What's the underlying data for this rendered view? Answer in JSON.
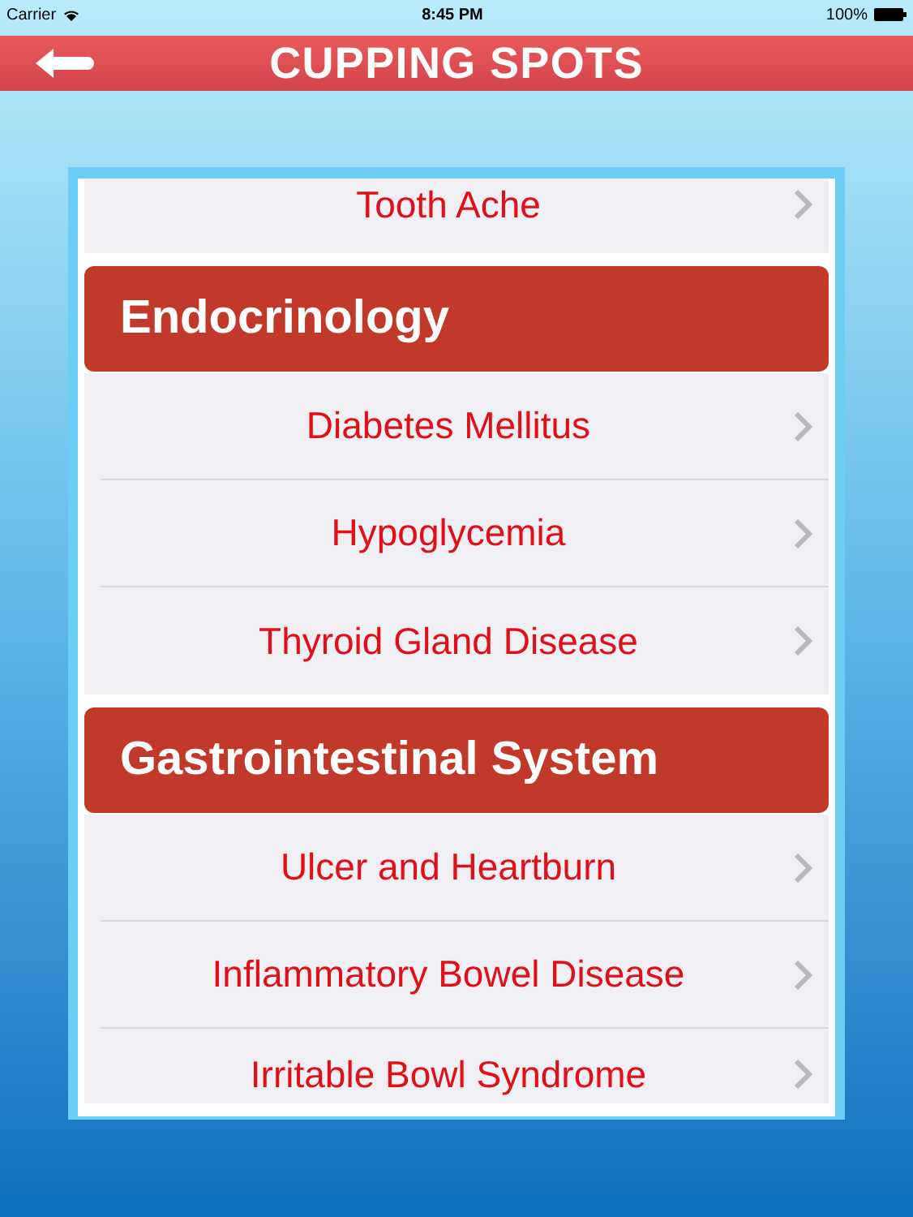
{
  "status_bar": {
    "carrier": "Carrier",
    "time": "8:45 PM",
    "battery": "100%"
  },
  "header": {
    "title": "CUPPING SPOTS"
  },
  "rows": [
    {
      "kind": "item",
      "label": "Tooth Ache"
    },
    {
      "kind": "section",
      "label": "Endocrinology"
    },
    {
      "kind": "item",
      "label": "Diabetes Mellitus"
    },
    {
      "kind": "item",
      "label": "Hypoglycemia"
    },
    {
      "kind": "item",
      "label": "Thyroid Gland Disease"
    },
    {
      "kind": "section",
      "label": "Gastrointestinal System"
    },
    {
      "kind": "item",
      "label": "Ulcer and Heartburn"
    },
    {
      "kind": "item",
      "label": "Inflammatory Bowel Disease"
    },
    {
      "kind": "item",
      "label": "Irritable Bowl Syndrome"
    }
  ]
}
